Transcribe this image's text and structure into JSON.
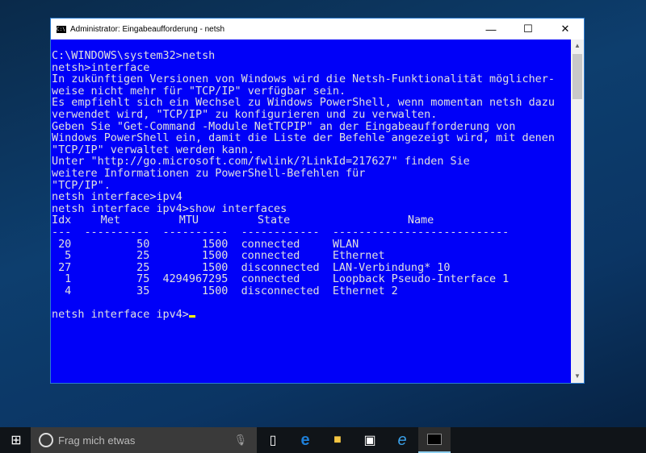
{
  "window": {
    "title": "Administrator: Eingabeaufforderung - netsh",
    "minimize": "—",
    "maximize": "☐",
    "close": "✕"
  },
  "console": {
    "lines_before": [
      "C:\\WINDOWS\\system32>netsh",
      "netsh>interface",
      "In zukünftigen Versionen von Windows wird die Netsh-Funktionalität möglicher-",
      "weise nicht mehr für \"TCP/IP\" verfügbar sein.",
      "",
      "Es empfiehlt sich ein Wechsel zu Windows PowerShell, wenn momentan netsh dazu",
      "verwendet wird, \"TCP/IP\" zu konfigurieren und zu verwalten.",
      "",
      "Geben Sie \"Get-Command -Module NetTCPIP\" an der Eingabeaufforderung von",
      "Windows PowerShell ein, damit die Liste der Befehle angezeigt wird, mit denen",
      "\"TCP/IP\" verwaltet werden kann.",
      "",
      "Unter \"http://go.microsoft.com/fwlink/?LinkId=217627\" finden Sie",
      "weitere Informationen zu PowerShell-Befehlen für",
      "\"TCP/IP\".",
      "netsh interface>ipv4",
      "netsh interface ipv4>show interfaces",
      ""
    ],
    "table": {
      "headers": [
        "Idx",
        "Met",
        "MTU",
        "State",
        "Name"
      ],
      "rows": [
        [
          "20",
          "50",
          "1500",
          "connected",
          "WLAN"
        ],
        [
          "5",
          "25",
          "1500",
          "connected",
          "Ethernet"
        ],
        [
          "27",
          "25",
          "1500",
          "disconnected",
          "LAN-Verbindung* 10"
        ],
        [
          "1",
          "75",
          "4294967295",
          "connected",
          "Loopback Pseudo-Interface 1"
        ],
        [
          "4",
          "35",
          "1500",
          "disconnected",
          "Ethernet 2"
        ]
      ]
    },
    "prompt": "netsh interface ipv4>"
  },
  "taskbar": {
    "search_placeholder": "Frag mich etwas"
  }
}
